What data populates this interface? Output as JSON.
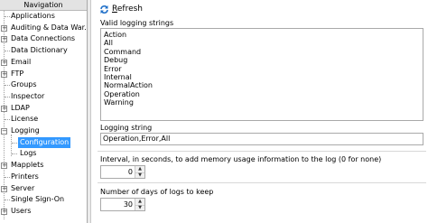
{
  "navigation": {
    "title": "Navigation",
    "items": [
      {
        "label": "Applications",
        "expandable": false,
        "level": 0
      },
      {
        "label": "Auditing & Data War...",
        "expandable": true,
        "level": 0
      },
      {
        "label": "Data Connections",
        "expandable": true,
        "level": 0
      },
      {
        "label": "Data Dictionary",
        "expandable": false,
        "level": 0
      },
      {
        "label": "Email",
        "expandable": true,
        "level": 0
      },
      {
        "label": "FTP",
        "expandable": true,
        "level": 0
      },
      {
        "label": "Groups",
        "expandable": false,
        "level": 0
      },
      {
        "label": "Inspector",
        "expandable": false,
        "level": 0
      },
      {
        "label": "LDAP",
        "expandable": true,
        "level": 0
      },
      {
        "label": "License",
        "expandable": false,
        "level": 0
      },
      {
        "label": "Logging",
        "expandable": true,
        "expanded": true,
        "level": 0
      },
      {
        "label": "Configuration",
        "expandable": false,
        "level": 1,
        "selected": true
      },
      {
        "label": "Logs",
        "expandable": false,
        "level": 1
      },
      {
        "label": "Mapplets",
        "expandable": true,
        "level": 0
      },
      {
        "label": "Printers",
        "expandable": false,
        "level": 0
      },
      {
        "label": "Server",
        "expandable": true,
        "level": 0
      },
      {
        "label": "Single Sign-On",
        "expandable": false,
        "level": 0
      },
      {
        "label": "Users",
        "expandable": true,
        "level": 0
      }
    ]
  },
  "toolbar": {
    "refresh_label_underlined": "R",
    "refresh_label_rest": "efresh"
  },
  "config": {
    "valid_strings_caption": "Valid logging strings",
    "valid_strings": [
      "Action",
      "All",
      "Command",
      "Debug",
      "Error",
      "Internal",
      "NormalAction",
      "Operation",
      "Warning"
    ],
    "logging_string_caption": "Logging string",
    "logging_string_value": "Operation,Error,All",
    "interval_caption": "Interval, in seconds, to add memory usage information to the log (0 for none)",
    "interval_value": "0",
    "days_caption": "Number of days of logs to keep",
    "days_value": "30"
  },
  "colors": {
    "selection": "#3399ff",
    "refresh_icon": "#1f6fc8"
  }
}
